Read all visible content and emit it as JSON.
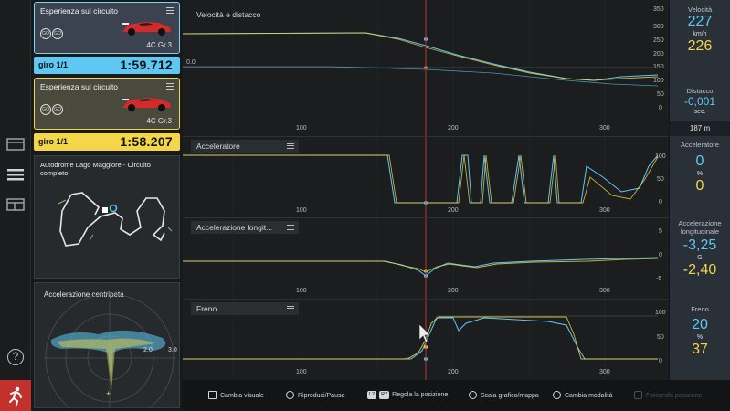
{
  "sidebar": {
    "icons": [
      "grid-layout-icon",
      "list-layout-icon",
      "split-layout-icon"
    ],
    "help_label": "?",
    "exit_icon": "runner-exit-icon"
  },
  "cars": [
    {
      "title": "Esperienza sul circuito",
      "badges": [
        "GO",
        "GO"
      ],
      "car_name": "4C Gr.3",
      "lap_label": "giro 1/1",
      "lap_time": "1:59.712",
      "color": "#5ec8f3"
    },
    {
      "title": "Esperienza sul circuito",
      "badges": [
        "GO",
        "GO"
      ],
      "car_name": "4C Gr.3",
      "lap_label": "giro 1/1",
      "lap_time": "1:58.207",
      "color": "#f4d748"
    }
  ],
  "track_map": {
    "title": "Autodrome Lago Maggiore - Circuito completo"
  },
  "gg_diagram": {
    "title": "Accelerazione centripeta",
    "scale_labels": [
      "2.0",
      "3.0"
    ]
  },
  "charts": {
    "x_ticks": [
      "100",
      "200",
      "300"
    ],
    "panels": [
      {
        "title": "Velocità e distacco",
        "y_ticks": [
          "350",
          "300",
          "250",
          "200",
          "150",
          "100",
          "50",
          "0"
        ],
        "zero_label": "0.0"
      },
      {
        "title": "Acceleratore",
        "y_ticks": [
          "100",
          "50",
          "0"
        ]
      },
      {
        "title": "Accelerazione longit...",
        "y_ticks": [
          "5",
          "0",
          "-5"
        ]
      },
      {
        "title": "Freno",
        "y_ticks": [
          "100",
          "50",
          "0"
        ]
      }
    ]
  },
  "readouts": {
    "speed": {
      "caption": "Velocità",
      "value_blue": "227",
      "unit": "km/h",
      "value_yellow": "226"
    },
    "gap": {
      "caption": "Distacco",
      "value_blue": "-0,001",
      "unit": "sec."
    },
    "distance": "187 m",
    "throttle": {
      "caption": "Acceleratore",
      "value_blue": "0",
      "unit": "%",
      "value_yellow": "0"
    },
    "long_accel": {
      "caption": "Accelerazione longitudinale",
      "value_blue": "-3,25",
      "unit": "G",
      "value_yellow": "-2,40"
    },
    "brake": {
      "caption": "Freno",
      "value_blue": "20",
      "unit": "%",
      "value_yellow": "37"
    }
  },
  "hints": [
    {
      "glyph": "dpad",
      "label": "Cambia visuale"
    },
    {
      "glyph": "circle",
      "label": "Riproduci/Pausa"
    },
    {
      "glyph": "L2 R2",
      "label": "Regola la posizione"
    },
    {
      "glyph": "stick",
      "label": "Scala grafico/mappa"
    },
    {
      "glyph": "triangle",
      "label": "Cambia modalità"
    },
    {
      "glyph": "camera",
      "label": "Fotografa posizione"
    }
  ],
  "colors": {
    "blue_series": "#5ec8f3",
    "yellow_series": "#f4d748",
    "cursor": "#c0322b"
  }
}
